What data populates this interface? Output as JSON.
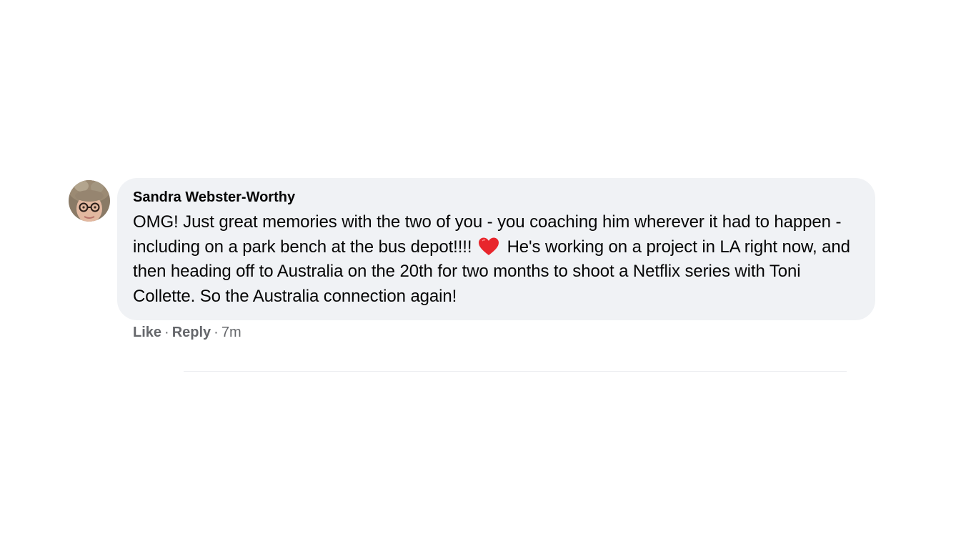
{
  "comment": {
    "author": "Sandra Webster-Worthy",
    "text_part1": "OMG! Just great memories with the two of you - you coaching him wherever it had to happen - including on a park bench at the bus depot!!!!",
    "emoji": "heart-icon",
    "text_part2": "He's working on a project in LA right now, and then heading off to Australia on the 20th for two months to shoot a Netflix series with Toni Collette. So the Australia connection again!",
    "actions": {
      "like_label": "Like",
      "reply_label": "Reply",
      "separator": "·",
      "timestamp": "7m"
    }
  },
  "colors": {
    "bubble_background": "#f0f2f5",
    "text": "#050505",
    "secondary_text": "#65676b",
    "heart": "#e8262c"
  }
}
